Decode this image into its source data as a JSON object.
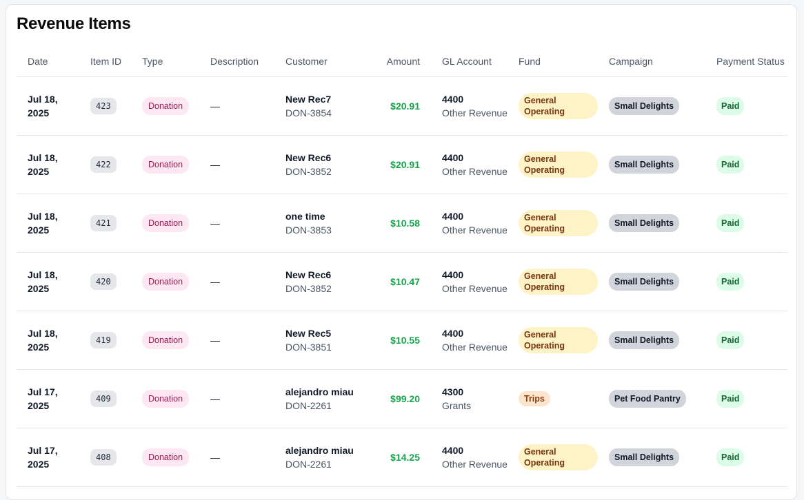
{
  "page": {
    "title": "Revenue Items"
  },
  "columns": {
    "date": "Date",
    "item_id": "Item ID",
    "type": "Type",
    "description": "Description",
    "customer": "Customer",
    "amount": "Amount",
    "gl_account": "GL Account",
    "fund": "Fund",
    "campaign": "Campaign",
    "payment_status": "Payment Status"
  },
  "rows": [
    {
      "date": "Jul 18, 2025",
      "item_id": "423",
      "type": "Donation",
      "description": "—",
      "customer_name": "New Rec7",
      "customer_code": "DON-3854",
      "amount": "$20.91",
      "gl_code": "4400",
      "gl_name": "Other Revenue",
      "fund": "General Operating",
      "campaign": "Small Delights",
      "payment_status": "Paid"
    },
    {
      "date": "Jul 18, 2025",
      "item_id": "422",
      "type": "Donation",
      "description": "—",
      "customer_name": "New Rec6",
      "customer_code": "DON-3852",
      "amount": "$20.91",
      "gl_code": "4400",
      "gl_name": "Other Revenue",
      "fund": "General Operating",
      "campaign": "Small Delights",
      "payment_status": "Paid"
    },
    {
      "date": "Jul 18, 2025",
      "item_id": "421",
      "type": "Donation",
      "description": "—",
      "customer_name": "one time",
      "customer_code": "DON-3853",
      "amount": "$10.58",
      "gl_code": "4400",
      "gl_name": "Other Revenue",
      "fund": "General Operating",
      "campaign": "Small Delights",
      "payment_status": "Paid"
    },
    {
      "date": "Jul 18, 2025",
      "item_id": "420",
      "type": "Donation",
      "description": "—",
      "customer_name": "New Rec6",
      "customer_code": "DON-3852",
      "amount": "$10.47",
      "gl_code": "4400",
      "gl_name": "Other Revenue",
      "fund": "General Operating",
      "campaign": "Small Delights",
      "payment_status": "Paid"
    },
    {
      "date": "Jul 18, 2025",
      "item_id": "419",
      "type": "Donation",
      "description": "—",
      "customer_name": "New Rec5",
      "customer_code": "DON-3851",
      "amount": "$10.55",
      "gl_code": "4400",
      "gl_name": "Other Revenue",
      "fund": "General Operating",
      "campaign": "Small Delights",
      "payment_status": "Paid"
    },
    {
      "date": "Jul 17, 2025",
      "item_id": "409",
      "type": "Donation",
      "description": "—",
      "customer_name": "alejandro miau",
      "customer_code": "DON-2261",
      "amount": "$99.20",
      "gl_code": "4300",
      "gl_name": "Grants",
      "fund": "Trips",
      "campaign": "Pet Food Pantry",
      "payment_status": "Paid"
    },
    {
      "date": "Jul 17, 2025",
      "item_id": "408",
      "type": "Donation",
      "description": "—",
      "customer_name": "alejandro miau",
      "customer_code": "DON-2261",
      "amount": "$14.25",
      "gl_code": "4400",
      "gl_name": "Other Revenue",
      "fund": "General Operating",
      "campaign": "Small Delights",
      "payment_status": "Paid"
    }
  ]
}
